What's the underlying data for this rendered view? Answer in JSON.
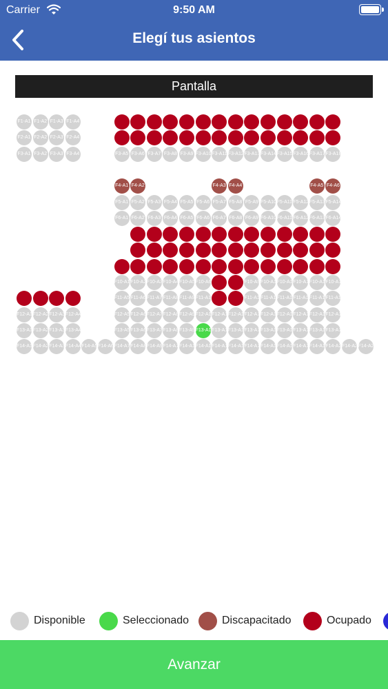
{
  "status_bar": {
    "carrier": "Carrier",
    "time": "9:50 AM"
  },
  "header": {
    "title": "Elegí tus asientos",
    "back_icon": "chevron-left-icon"
  },
  "screen_label": "Pantalla",
  "legend": [
    {
      "label": "Disponible",
      "color": "#d3d3d3"
    },
    {
      "label": "Seleccionado",
      "color": "#49d94a"
    },
    {
      "label": "Discapacitado",
      "color": "#a14f48"
    },
    {
      "label": "Ocupado",
      "color": "#b3001b"
    },
    {
      "label": "",
      "color": "#2a2ad6"
    }
  ],
  "footer": {
    "button_label": "Avanzar"
  },
  "seat_rows": [
    [
      {
        "label": "F1-A1"
      },
      {
        "label": "F1-A2"
      },
      {
        "label": "F1-A3"
      },
      {
        "label": "F1-A4"
      },
      null,
      null,
      {
        "label": "",
        "status": "occupied"
      },
      {
        "label": "",
        "status": "occupied"
      },
      {
        "label": "",
        "status": "occupied"
      },
      {
        "label": "",
        "status": "occupied"
      },
      {
        "label": "",
        "status": "occupied"
      },
      {
        "label": "",
        "status": "occupied"
      },
      {
        "label": "",
        "status": "occupied"
      },
      {
        "label": "",
        "status": "occupied"
      },
      {
        "label": "",
        "status": "occupied"
      },
      {
        "label": "",
        "status": "occupied"
      },
      {
        "label": "",
        "status": "occupied"
      },
      {
        "label": "",
        "status": "occupied"
      },
      {
        "label": "",
        "status": "occupied"
      },
      {
        "label": "",
        "status": "occupied"
      },
      null,
      null
    ],
    [
      {
        "label": "F2-A1"
      },
      {
        "label": "F2-A2"
      },
      {
        "label": "F2-A3"
      },
      {
        "label": "F2-A4"
      },
      null,
      null,
      {
        "label": "",
        "status": "occupied"
      },
      {
        "label": "",
        "status": "occupied"
      },
      {
        "label": "",
        "status": "occupied"
      },
      {
        "label": "",
        "status": "occupied"
      },
      {
        "label": "",
        "status": "occupied"
      },
      {
        "label": "",
        "status": "occupied"
      },
      {
        "label": "",
        "status": "occupied"
      },
      {
        "label": "",
        "status": "occupied"
      },
      {
        "label": "",
        "status": "occupied"
      },
      {
        "label": "",
        "status": "occupied"
      },
      {
        "label": "",
        "status": "occupied"
      },
      {
        "label": "",
        "status": "occupied"
      },
      {
        "label": "",
        "status": "occupied"
      },
      {
        "label": "",
        "status": "occupied"
      },
      null,
      null
    ],
    [
      {
        "label": "F3-A1"
      },
      {
        "label": "F3-A2"
      },
      {
        "label": "F3-A3"
      },
      {
        "label": "F3-A4"
      },
      null,
      null,
      {
        "label": "F3-A5"
      },
      {
        "label": "F3-A6"
      },
      {
        "label": "F3-A7"
      },
      {
        "label": "F3-A8"
      },
      {
        "label": "F3-A9"
      },
      {
        "label": "F3-A10"
      },
      {
        "label": "F3-A11"
      },
      {
        "label": "F3-A12"
      },
      {
        "label": "F3-A13"
      },
      {
        "label": "F3-A14"
      },
      {
        "label": "F3-A15"
      },
      {
        "label": "F3-A16"
      },
      {
        "label": "F3-A17"
      },
      {
        "label": "F3-A18"
      },
      null,
      null
    ],
    [
      null,
      null,
      null,
      null,
      null,
      null,
      null,
      null,
      null,
      null,
      null,
      null,
      null,
      null,
      null,
      null,
      null,
      null,
      null,
      null,
      null,
      null
    ],
    [
      null,
      null,
      null,
      null,
      null,
      null,
      {
        "label": "F4-A1",
        "status": "disabled"
      },
      {
        "label": "F4-A2",
        "status": "disabled"
      },
      null,
      null,
      null,
      null,
      {
        "label": "F4-A3",
        "status": "disabled"
      },
      {
        "label": "F4-A4",
        "status": "disabled"
      },
      null,
      null,
      null,
      null,
      {
        "label": "F4-A5",
        "status": "disabled"
      },
      {
        "label": "F4-A6",
        "status": "disabled"
      },
      null,
      null
    ],
    [
      null,
      null,
      null,
      null,
      null,
      null,
      {
        "label": "F5-A1"
      },
      {
        "label": "F5-A2"
      },
      {
        "label": "F5-A3"
      },
      {
        "label": "F5-A4"
      },
      {
        "label": "F5-A5"
      },
      {
        "label": "F5-A6"
      },
      {
        "label": "F5-A7"
      },
      {
        "label": "F5-A8"
      },
      {
        "label": "F5-A9"
      },
      {
        "label": "F5-A10"
      },
      {
        "label": "F5-A11"
      },
      {
        "label": "F5-A12"
      },
      {
        "label": "F5-A13"
      },
      {
        "label": "F5-A14"
      },
      null,
      null
    ],
    [
      null,
      null,
      null,
      null,
      null,
      null,
      {
        "label": "F6-A1"
      },
      {
        "label": "F6-A2"
      },
      {
        "label": "F6-A3"
      },
      {
        "label": "F6-A4"
      },
      {
        "label": "F6-A5"
      },
      {
        "label": "F6-A6"
      },
      {
        "label": "F6-A7"
      },
      {
        "label": "F6-A8"
      },
      {
        "label": "F6-A9"
      },
      {
        "label": "F6-A10"
      },
      {
        "label": "F6-A11"
      },
      {
        "label": "F6-A12"
      },
      {
        "label": "F6-A13"
      },
      {
        "label": "F6-A14"
      },
      null,
      null
    ],
    [
      null,
      null,
      null,
      null,
      null,
      null,
      null,
      {
        "label": "",
        "status": "occupied"
      },
      {
        "label": "",
        "status": "occupied"
      },
      {
        "label": "",
        "status": "occupied"
      },
      {
        "label": "",
        "status": "occupied"
      },
      {
        "label": "",
        "status": "occupied"
      },
      {
        "label": "",
        "status": "occupied"
      },
      {
        "label": "",
        "status": "occupied"
      },
      {
        "label": "",
        "status": "occupied"
      },
      {
        "label": "",
        "status": "occupied"
      },
      {
        "label": "",
        "status": "occupied"
      },
      {
        "label": "",
        "status": "occupied"
      },
      {
        "label": "",
        "status": "occupied"
      },
      {
        "label": "",
        "status": "occupied"
      },
      null,
      null
    ],
    [
      null,
      null,
      null,
      null,
      null,
      null,
      null,
      {
        "label": "",
        "status": "occupied"
      },
      {
        "label": "",
        "status": "occupied"
      },
      {
        "label": "",
        "status": "occupied"
      },
      {
        "label": "",
        "status": "occupied"
      },
      {
        "label": "",
        "status": "occupied"
      },
      {
        "label": "",
        "status": "occupied"
      },
      {
        "label": "",
        "status": "occupied"
      },
      {
        "label": "",
        "status": "occupied"
      },
      {
        "label": "",
        "status": "occupied"
      },
      {
        "label": "",
        "status": "occupied"
      },
      {
        "label": "",
        "status": "occupied"
      },
      {
        "label": "",
        "status": "occupied"
      },
      {
        "label": "",
        "status": "occupied"
      },
      null,
      null
    ],
    [
      null,
      null,
      null,
      null,
      null,
      null,
      {
        "label": "",
        "status": "occupied"
      },
      {
        "label": "",
        "status": "occupied"
      },
      {
        "label": "",
        "status": "occupied"
      },
      {
        "label": "",
        "status": "occupied"
      },
      {
        "label": "",
        "status": "occupied"
      },
      {
        "label": "",
        "status": "occupied"
      },
      {
        "label": "",
        "status": "occupied"
      },
      {
        "label": "",
        "status": "occupied"
      },
      {
        "label": "",
        "status": "occupied"
      },
      {
        "label": "",
        "status": "occupied"
      },
      {
        "label": "",
        "status": "occupied"
      },
      {
        "label": "",
        "status": "occupied"
      },
      {
        "label": "",
        "status": "occupied"
      },
      {
        "label": "",
        "status": "occupied"
      },
      null,
      null
    ],
    [
      null,
      null,
      null,
      null,
      null,
      null,
      {
        "label": "F10-A1"
      },
      {
        "label": "F10-A2"
      },
      {
        "label": "F10-A3"
      },
      {
        "label": "F10-A4"
      },
      {
        "label": "F10-A5"
      },
      {
        "label": "F10-A6"
      },
      {
        "label": "",
        "status": "occupied"
      },
      {
        "label": "",
        "status": "occupied"
      },
      {
        "label": "F10-A9"
      },
      {
        "label": "F10-A10"
      },
      {
        "label": "F10-A11"
      },
      {
        "label": "F10-A12"
      },
      {
        "label": "F10-A13"
      },
      {
        "label": "F10-A14"
      },
      null,
      null
    ],
    [
      {
        "label": "",
        "status": "occupied"
      },
      {
        "label": "",
        "status": "occupied"
      },
      {
        "label": "",
        "status": "occupied"
      },
      {
        "label": "",
        "status": "occupied"
      },
      null,
      null,
      {
        "label": "F11-A5"
      },
      {
        "label": "F11-A6"
      },
      {
        "label": "F11-A7"
      },
      {
        "label": "F11-A8"
      },
      {
        "label": "F11-A9"
      },
      {
        "label": "F11-A10"
      },
      {
        "label": "",
        "status": "occupied"
      },
      {
        "label": "",
        "status": "occupied"
      },
      {
        "label": "F11-A13"
      },
      {
        "label": "F11-A14"
      },
      {
        "label": "F11-A15"
      },
      {
        "label": "F11-A16"
      },
      {
        "label": "F11-A17"
      },
      {
        "label": "F11-A18"
      },
      null,
      null
    ],
    [
      {
        "label": "F12-A1"
      },
      {
        "label": "F12-A2"
      },
      {
        "label": "F12-A3"
      },
      {
        "label": "F12-A4"
      },
      null,
      null,
      {
        "label": "F12-A5"
      },
      {
        "label": "F12-A6"
      },
      {
        "label": "F12-A7"
      },
      {
        "label": "F12-A8"
      },
      {
        "label": "F12-A9"
      },
      {
        "label": "F12-A10"
      },
      {
        "label": "F12-A11"
      },
      {
        "label": "F12-A12"
      },
      {
        "label": "F12-A13"
      },
      {
        "label": "F12-A14"
      },
      {
        "label": "F12-A15"
      },
      {
        "label": "F12-A16"
      },
      {
        "label": "F12-A17"
      },
      {
        "label": "F12-A18"
      },
      null,
      null
    ],
    [
      {
        "label": "F13-A1"
      },
      {
        "label": "F13-A2"
      },
      {
        "label": "F13-A3"
      },
      {
        "label": "F13-A4"
      },
      null,
      null,
      {
        "label": "F13-A5"
      },
      {
        "label": "F13-A6"
      },
      {
        "label": "F13-A7"
      },
      {
        "label": "F13-A8"
      },
      {
        "label": "F13-A9"
      },
      {
        "label": "F13-A10",
        "status": "selected"
      },
      {
        "label": "F13-A11"
      },
      {
        "label": "F13-A12"
      },
      {
        "label": "F13-A13"
      },
      {
        "label": "F13-A14"
      },
      {
        "label": "F13-A15"
      },
      {
        "label": "F13-A16"
      },
      {
        "label": "F13-A17"
      },
      {
        "label": "F13-A18"
      },
      null,
      null
    ],
    [
      {
        "label": "F14-A1"
      },
      {
        "label": "F14-A2"
      },
      {
        "label": "F14-A3"
      },
      {
        "label": "F14-A4"
      },
      {
        "label": "F14-A5"
      },
      {
        "label": "F14-A6"
      },
      {
        "label": "F14-A7"
      },
      {
        "label": "F14-A8"
      },
      {
        "label": "F14-A9"
      },
      {
        "label": "F14-A10"
      },
      {
        "label": "F14-A11"
      },
      {
        "label": "F14-A12"
      },
      {
        "label": "F14-A13"
      },
      {
        "label": "F14-A14"
      },
      {
        "label": "F14-A15"
      },
      {
        "label": "F14-A16"
      },
      {
        "label": "F14-A17"
      },
      {
        "label": "F14-A18"
      },
      {
        "label": "F14-A19"
      },
      {
        "label": "F14-A20"
      },
      {
        "label": "F14-A21"
      },
      {
        "label": "F14-A22"
      }
    ]
  ]
}
